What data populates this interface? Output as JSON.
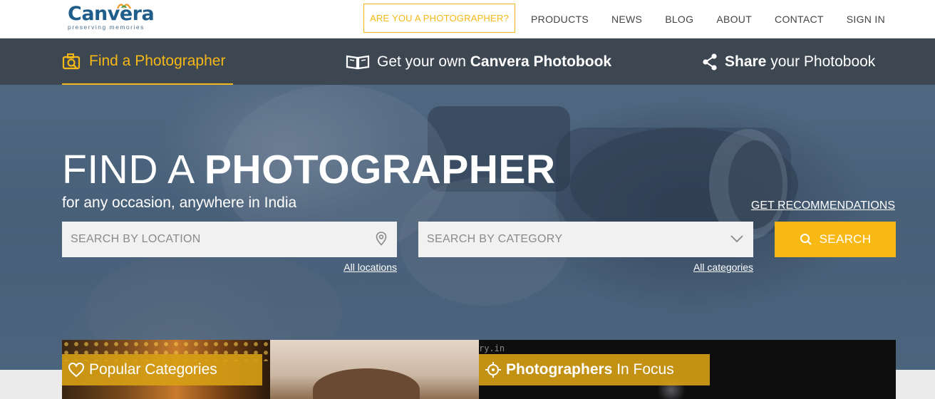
{
  "header": {
    "logo_text": "Canvera",
    "logo_tagline": "preserving memories",
    "photographer_button": "ARE YOU A PHOTOGRAPHER?",
    "nav": [
      "PRODUCTS",
      "NEWS",
      "BLOG",
      "ABOUT",
      "CONTACT",
      "SIGN IN"
    ]
  },
  "subnav": {
    "find": {
      "prefix": "Find a ",
      "strong": "Photographer"
    },
    "photobook": {
      "prefix": "Get your own ",
      "strong": "Canvera Photobook"
    },
    "share": {
      "strong": "Share",
      "suffix": " your Photobook"
    }
  },
  "hero": {
    "title_light": "FIND A ",
    "title_bold": "PHOTOGRAPHER",
    "subtitle": "for any occasion, anywhere in India",
    "recommendations_link": "GET RECOMMENDATIONS",
    "location_placeholder": "SEARCH BY LOCATION",
    "category_placeholder": "SEARCH BY CATEGORY",
    "all_locations": "All locations",
    "all_categories": "All categories",
    "search_button": "SEARCH",
    "watermark": "ry.in"
  },
  "cards": {
    "popular": "Popular Categories",
    "focus_strong": "Photographers",
    "focus_suffix": " In Focus"
  },
  "colors": {
    "accent": "#f5b817",
    "subbar": "#3d4752",
    "brand": "#1f5d8a"
  }
}
